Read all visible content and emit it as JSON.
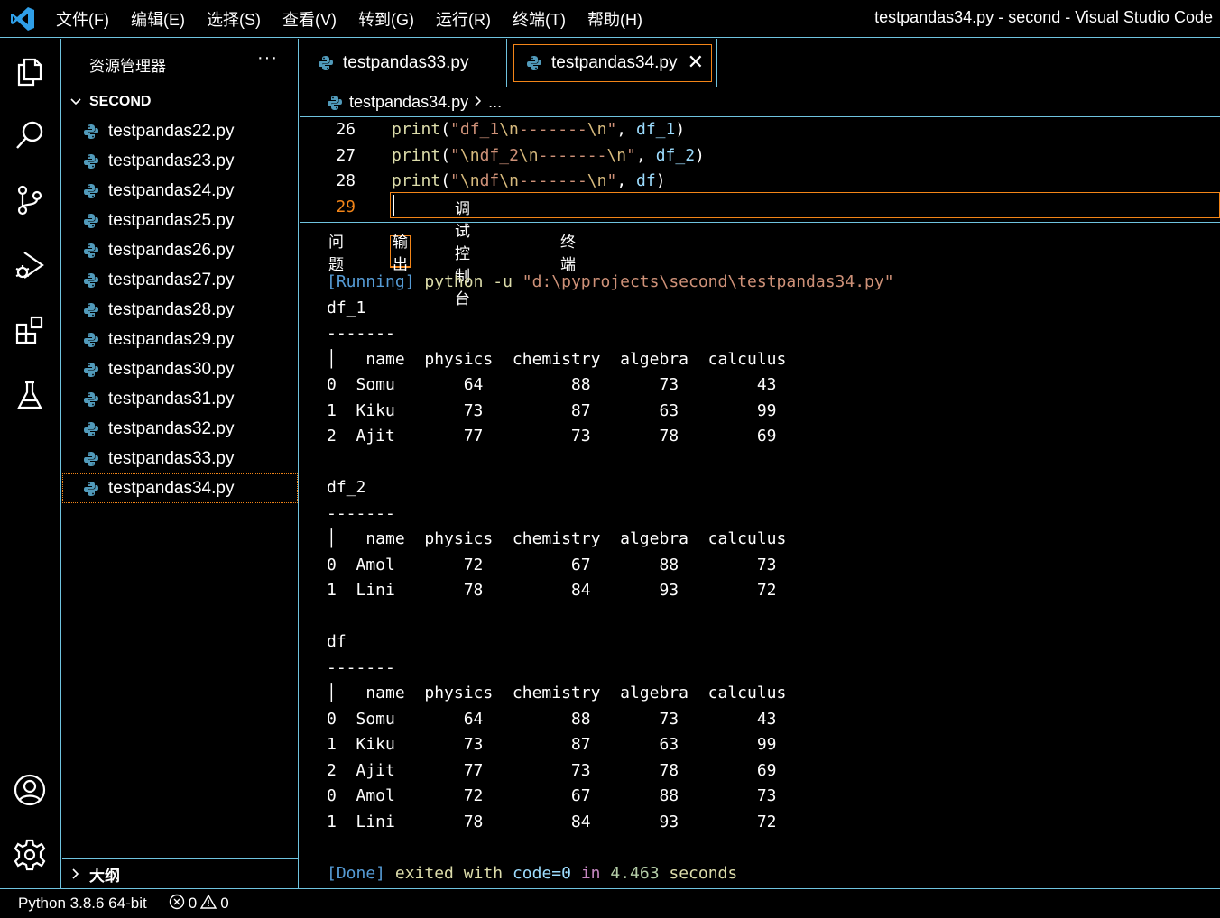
{
  "menu": [
    "文件(F)",
    "编辑(E)",
    "选择(S)",
    "查看(V)",
    "转到(G)",
    "运行(R)",
    "终端(T)",
    "帮助(H)"
  ],
  "window_title": "testpandas34.py - second - Visual Studio Code",
  "sidebar": {
    "title": "资源管理器",
    "more": "···",
    "folder": "SECOND",
    "files": [
      "testpandas22.py",
      "testpandas23.py",
      "testpandas24.py",
      "testpandas25.py",
      "testpandas26.py",
      "testpandas27.py",
      "testpandas28.py",
      "testpandas29.py",
      "testpandas30.py",
      "testpandas31.py",
      "testpandas32.py",
      "testpandas33.py",
      "testpandas34.py"
    ],
    "active_file": "testpandas34.py",
    "outline": "大纲"
  },
  "tabs": [
    {
      "label": "testpandas33.py",
      "active": false
    },
    {
      "label": "testpandas34.py",
      "active": true
    }
  ],
  "breadcrumb": {
    "file": "testpandas34.py",
    "rest": "..."
  },
  "editor": {
    "lines": [
      {
        "num": "26",
        "parts": [
          [
            "fn",
            "print"
          ],
          [
            "p",
            "("
          ],
          [
            "str",
            "\"df_1"
          ],
          [
            "esc",
            "\\n"
          ],
          [
            "str",
            "-------"
          ],
          [
            "esc",
            "\\n"
          ],
          [
            "str",
            "\""
          ],
          [
            "p",
            ", "
          ],
          [
            "var",
            "df_1"
          ],
          [
            "p",
            ")"
          ]
        ]
      },
      {
        "num": "27",
        "parts": [
          [
            "fn",
            "print"
          ],
          [
            "p",
            "("
          ],
          [
            "str",
            "\""
          ],
          [
            "esc",
            "\\n"
          ],
          [
            "str",
            "df_2"
          ],
          [
            "esc",
            "\\n"
          ],
          [
            "str",
            "-------"
          ],
          [
            "esc",
            "\\n"
          ],
          [
            "str",
            "\""
          ],
          [
            "p",
            ", "
          ],
          [
            "var",
            "df_2"
          ],
          [
            "p",
            ")"
          ]
        ]
      },
      {
        "num": "28",
        "parts": [
          [
            "fn",
            "print"
          ],
          [
            "p",
            "("
          ],
          [
            "str",
            "\""
          ],
          [
            "esc",
            "\\n"
          ],
          [
            "str",
            "df"
          ],
          [
            "esc",
            "\\n"
          ],
          [
            "str",
            "-------"
          ],
          [
            "esc",
            "\\n"
          ],
          [
            "str",
            "\""
          ],
          [
            "p",
            ", "
          ],
          [
            "var",
            "df"
          ],
          [
            "p",
            ")"
          ]
        ]
      },
      {
        "num": "29",
        "parts": []
      }
    ],
    "current_line": "29"
  },
  "panel": {
    "tabs": [
      "问题",
      "输出",
      "调试控制台",
      "终端"
    ],
    "active_tab": "输出",
    "running_tag": "[Running]",
    "command": "python -u ",
    "command_path": "\"d:\\pyprojects\\second\\testpandas34.py\"",
    "output_lines": [
      "df_1",
      "-------",
      "│   name  physics  chemistry  algebra  calculus",
      "0  Somu       64         88       73        43",
      "1  Kiku       73         87       63        99",
      "2  Ajit       77         73       78        69",
      "",
      "df_2",
      "-------",
      "│   name  physics  chemistry  algebra  calculus",
      "0  Amol       72         67       88        73",
      "1  Lini       78         84       93        72",
      "",
      "df",
      "-------",
      "│   name  physics  chemistry  algebra  calculus",
      "0  Somu       64         88       73        43",
      "1  Kiku       73         87       63        99",
      "2  Ajit       77         73       78        69",
      "0  Amol       72         67       88        73",
      "1  Lini       78         84       93        72",
      ""
    ],
    "done": {
      "tag": "[Done]",
      "exited": "exited with",
      "code": "code=0",
      "in": "in",
      "time": "4.463",
      "seconds": "seconds"
    }
  },
  "status": {
    "python": "Python 3.8.6 64-bit",
    "errors": "0",
    "warnings": "0"
  },
  "colors": {
    "border": "#6fc3df",
    "accent": "#f38518",
    "python_icon": "#519aba"
  },
  "icons": [
    "vscode-logo-icon",
    "explorer-icon",
    "search-icon",
    "source-control-icon",
    "run-debug-icon",
    "extensions-icon",
    "testing-icon",
    "account-icon",
    "settings-gear-icon",
    "python-file-icon",
    "close-icon",
    "chevron-down-icon",
    "chevron-right-icon",
    "error-icon",
    "warning-icon"
  ]
}
